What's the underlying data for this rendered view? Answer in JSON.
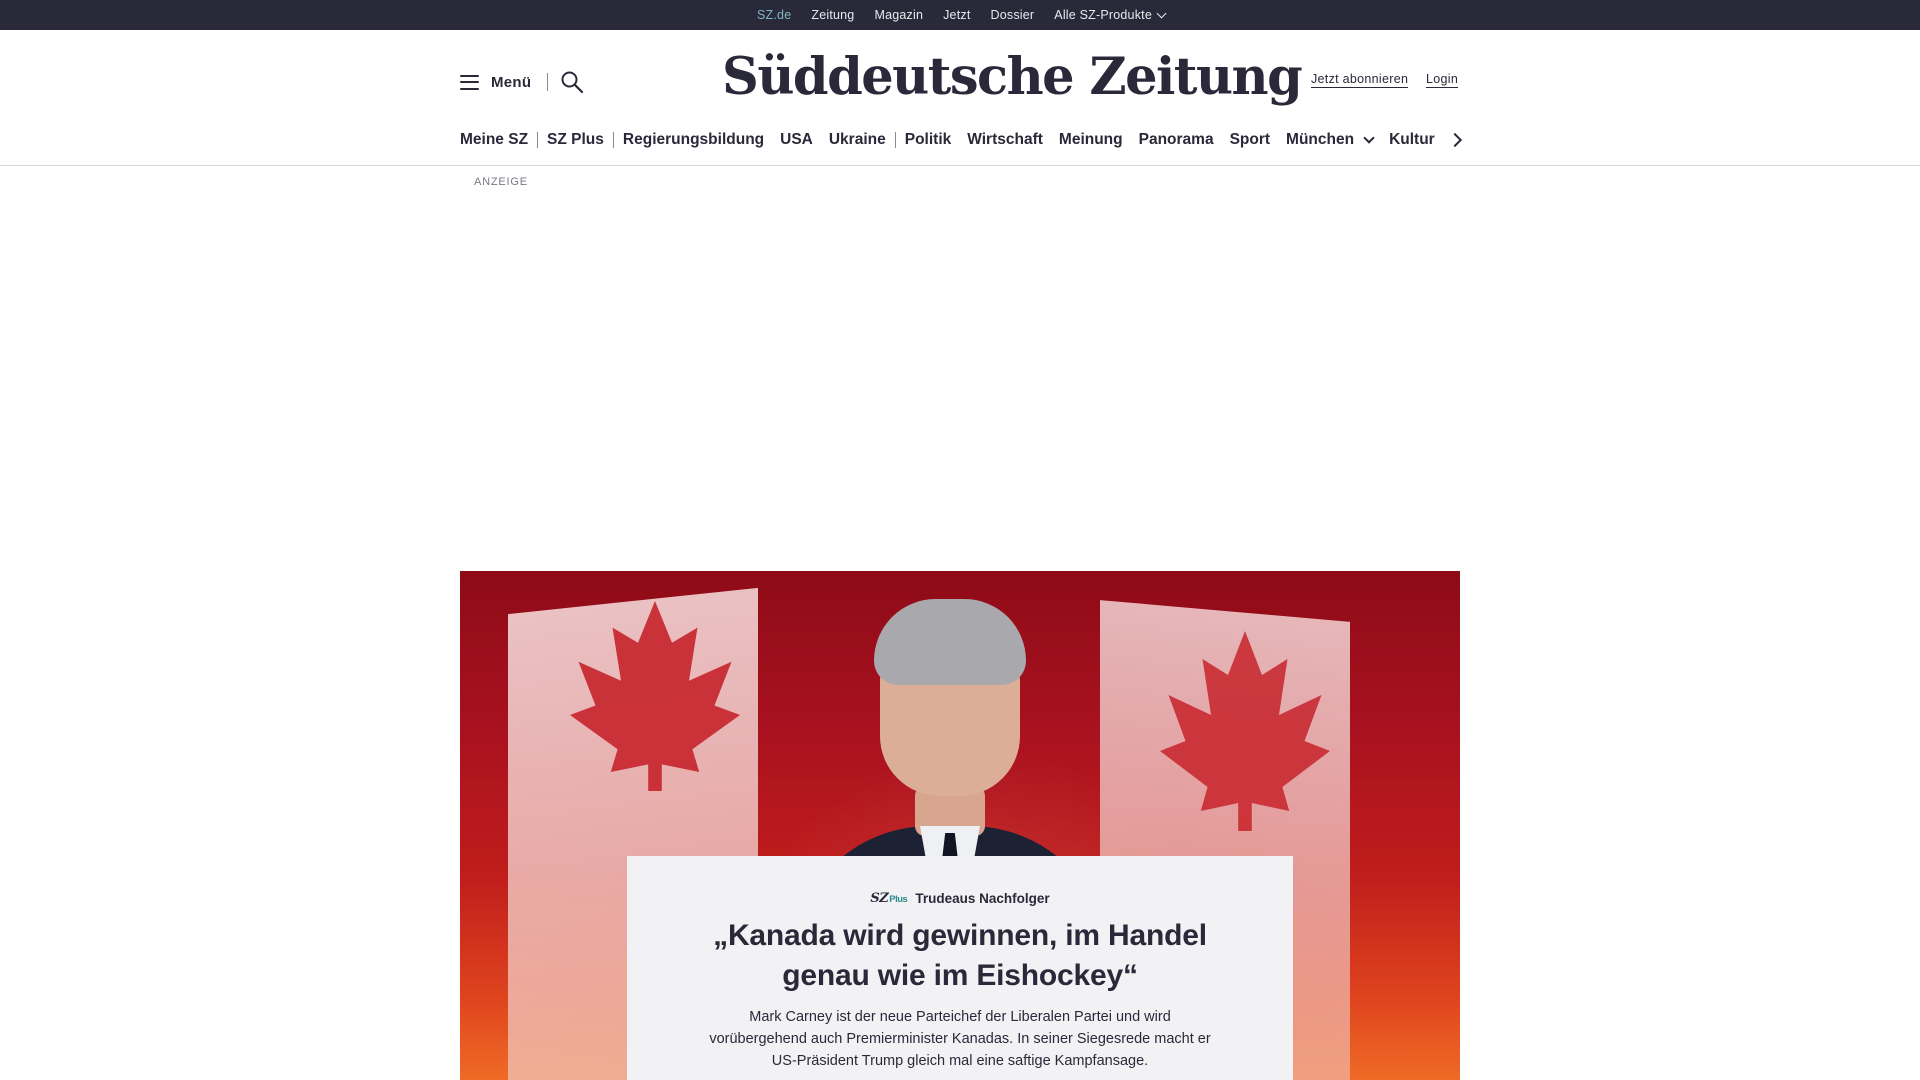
{
  "topbar": {
    "links": [
      "SZ.de",
      "Zeitung",
      "Magazin",
      "Jetzt",
      "Dossier",
      "Alle SZ-Produkte"
    ],
    "active": "SZ.de",
    "background": "#29293a",
    "active_color": "#7fb6c4"
  },
  "header": {
    "menu_label": "Menü",
    "logo_text": "Süddeutsche Zeitung",
    "subscribe_label": "Jetzt abonnieren",
    "login_label": "Login",
    "icons": [
      "menu-icon",
      "search-icon",
      "chevron-right-icon"
    ]
  },
  "nav": {
    "items": [
      "Meine SZ",
      "SZ Plus",
      "Regierungsbildung",
      "USA",
      "Ukraine",
      "Politik",
      "Wirtschaft",
      "Meinung",
      "Panorama",
      "Sport",
      "München",
      "Kultur"
    ]
  },
  "ad": {
    "label": "ANZEIGE"
  },
  "teaser": {
    "badge_main": "SZ",
    "badge_plus": "Plus",
    "kicker": "Trudeaus Nachfolger",
    "headline": "„Kanada wird gewinnen, im Handel genau wie im Eishockey“",
    "text": "Mark Carney ist der neue Parteichef der Liberalen Partei und wird vorübergehend auch Premierminister Kanadas. In seiner Siegesrede macht er US-Präsident Trump gleich mal eine saftige Kampfansage.",
    "badge_color": "#2a8c8c",
    "box_color": "#f2f2f4"
  }
}
